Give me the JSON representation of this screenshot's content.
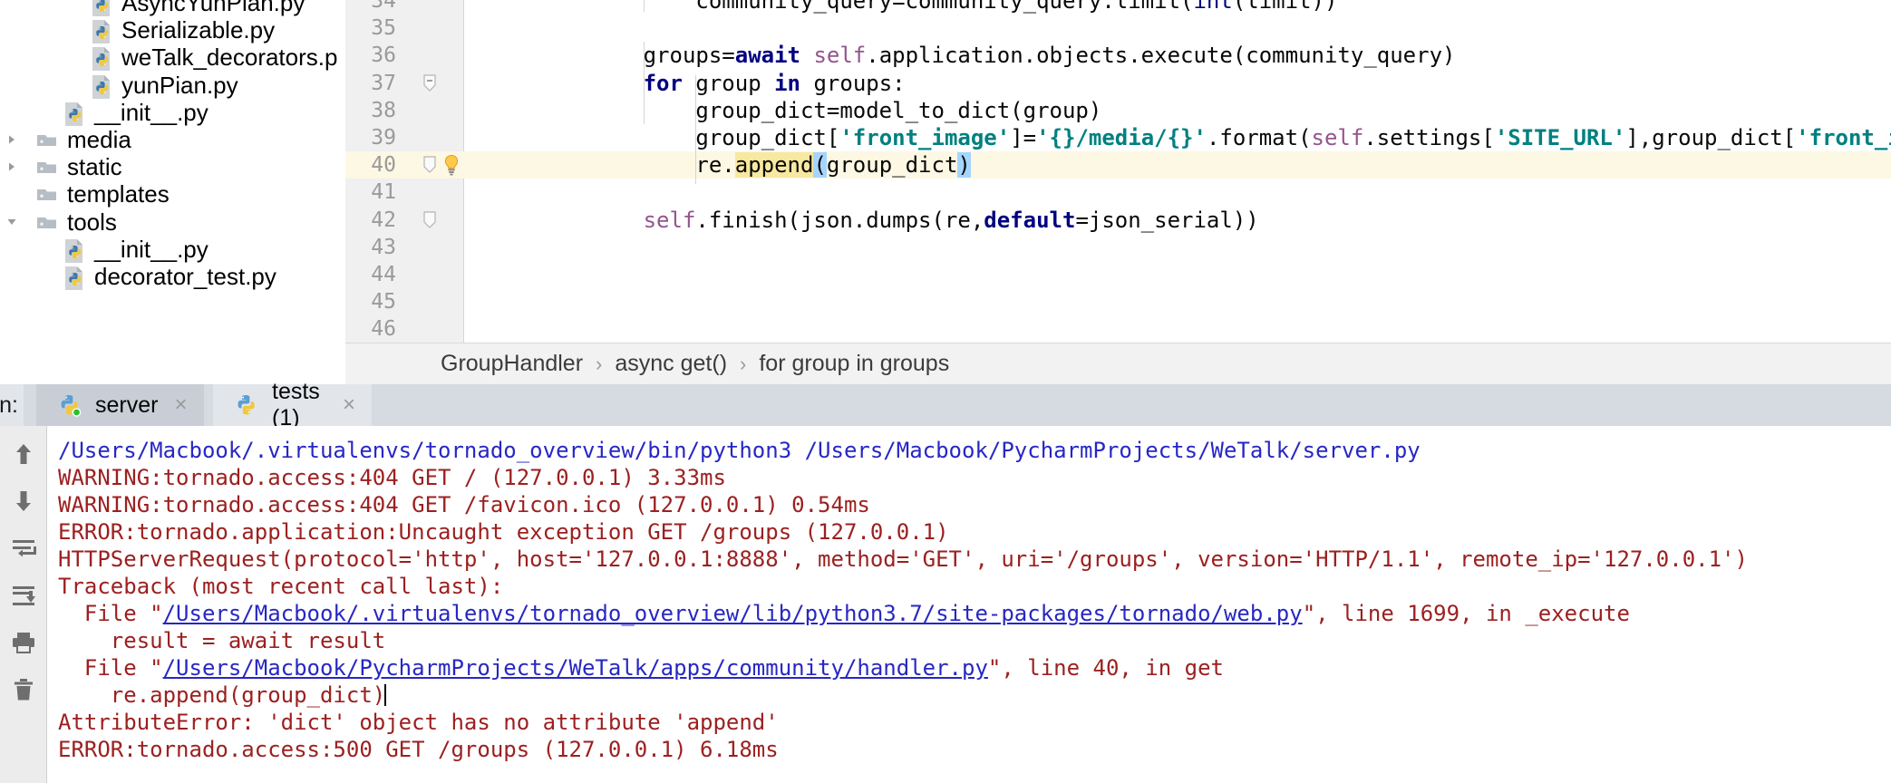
{
  "project_tree": {
    "name": "project-file-tree",
    "items": [
      {
        "label": "AsyncYunPian.py",
        "icon": "python-file-icon",
        "indent": 3,
        "type": "file",
        "expander": "none",
        "clipped_top": true
      },
      {
        "label": "Serializable.py",
        "icon": "python-file-icon",
        "indent": 3,
        "type": "file",
        "expander": "none"
      },
      {
        "label": "weTalk_decorators.p",
        "icon": "python-file-icon",
        "indent": 3,
        "type": "file",
        "expander": "none"
      },
      {
        "label": "yunPian.py",
        "icon": "python-file-icon",
        "indent": 3,
        "type": "file",
        "expander": "none"
      },
      {
        "label": "__init__.py",
        "icon": "python-file-icon",
        "indent": 2,
        "type": "file",
        "expander": "none"
      },
      {
        "label": "media",
        "icon": "folder-icon",
        "indent": 1,
        "type": "folder",
        "expander": "collapsed"
      },
      {
        "label": "static",
        "icon": "folder-icon",
        "indent": 1,
        "type": "folder",
        "expander": "collapsed"
      },
      {
        "label": "templates",
        "icon": "folder-icon",
        "indent": 1,
        "type": "folder",
        "expander": "none"
      },
      {
        "label": "tools",
        "icon": "folder-icon",
        "indent": 1,
        "type": "folder",
        "expander": "expanded"
      },
      {
        "label": "__init__.py",
        "icon": "python-file-icon",
        "indent": 2,
        "type": "file",
        "expander": "none"
      },
      {
        "label": "decorator_test.py",
        "icon": "python-file-icon",
        "indent": 2,
        "type": "file",
        "expander": "none"
      }
    ]
  },
  "editor": {
    "name": "code-editor",
    "first_line": 34,
    "highlighted_line": 40,
    "gutter_icons": {
      "fold_lines": [
        37,
        40,
        42
      ],
      "bulb_line": 40
    },
    "lines": [
      {
        "num": 34,
        "text": "            community_query=community_query.limit(int(limit))"
      },
      {
        "num": 35,
        "text": ""
      },
      {
        "num": 36,
        "text": "        groups=await self.application.objects.execute(community_query)"
      },
      {
        "num": 37,
        "text": "        for group in groups:"
      },
      {
        "num": 38,
        "text": "            group_dict=model_to_dict(group)"
      },
      {
        "num": 39,
        "text": "            group_dict['front_image']='{}/media/{}'.format(self.settings['SITE_URL'],group_dict['front_image'])"
      },
      {
        "num": 40,
        "text": "            re.append(group_dict)"
      },
      {
        "num": 41,
        "text": ""
      },
      {
        "num": 42,
        "text": "        self.finish(json.dumps(re,default=json_serial))"
      },
      {
        "num": 43,
        "text": ""
      },
      {
        "num": 44,
        "text": ""
      },
      {
        "num": 45,
        "text": ""
      },
      {
        "num": 46,
        "text": ""
      }
    ]
  },
  "breadcrumb": {
    "name": "editor-breadcrumb",
    "separator": "›",
    "items": [
      "GroupHandler",
      "async get()",
      "for group in groups"
    ]
  },
  "run_panel": {
    "name": "run-tool-window",
    "label_prefix": "n:",
    "tabs": [
      {
        "label": "server",
        "icon": "python-run-icon",
        "active": true,
        "running": true,
        "close": "×"
      },
      {
        "label": "tests (1)",
        "icon": "python-run-icon",
        "active": false,
        "running": false,
        "close": "×"
      }
    ],
    "toolbar": [
      {
        "name": "scroll-up-icon",
        "glyph": "arrow-up"
      },
      {
        "name": "scroll-down-icon",
        "glyph": "arrow-down"
      },
      {
        "name": "soft-wrap-icon",
        "glyph": "soft-wrap"
      },
      {
        "name": "scroll-to-end-icon",
        "glyph": "scroll-end"
      },
      {
        "name": "print-icon",
        "glyph": "printer"
      },
      {
        "name": "clear-all-icon",
        "glyph": "trash"
      }
    ],
    "console_lines": [
      {
        "style": "cmd",
        "parts": [
          {
            "t": "/Users/Macbook/.virtualenvs/tornado_overview/bin/python3 /Users/Macbook/PycharmProjects/WeTalk/server.py",
            "link": false
          }
        ]
      },
      {
        "style": "err",
        "parts": [
          {
            "t": "WARNING:tornado.access:404 GET / (127.0.0.1) 3.33ms",
            "link": false
          }
        ]
      },
      {
        "style": "err",
        "parts": [
          {
            "t": "WARNING:tornado.access:404 GET /favicon.ico (127.0.0.1) 0.54ms",
            "link": false
          }
        ]
      },
      {
        "style": "err",
        "parts": [
          {
            "t": "ERROR:tornado.application:Uncaught exception GET /groups (127.0.0.1)",
            "link": false
          }
        ]
      },
      {
        "style": "err",
        "parts": [
          {
            "t": "HTTPServerRequest(protocol='http', host='127.0.0.1:8888', method='GET', uri='/groups', version='HTTP/1.1', remote_ip='127.0.0.1')",
            "link": false
          }
        ]
      },
      {
        "style": "err",
        "parts": [
          {
            "t": "Traceback (most recent call last):",
            "link": false
          }
        ]
      },
      {
        "style": "err",
        "parts": [
          {
            "t": "  File \"",
            "link": false
          },
          {
            "t": "/Users/Macbook/.virtualenvs/tornado_overview/lib/python3.7/site-packages/tornado/web.py",
            "link": true
          },
          {
            "t": "\", line 1699, in _execute",
            "link": false
          }
        ]
      },
      {
        "style": "err",
        "parts": [
          {
            "t": "    result = await result",
            "link": false
          }
        ]
      },
      {
        "style": "err",
        "parts": [
          {
            "t": "  File \"",
            "link": false
          },
          {
            "t": "/Users/Macbook/PycharmProjects/WeTalk/apps/community/handler.py",
            "link": true
          },
          {
            "t": "\", line 40, in get",
            "link": false
          }
        ]
      },
      {
        "style": "err",
        "caret": true,
        "parts": [
          {
            "t": "    re.append(group_dict)",
            "link": false
          }
        ]
      },
      {
        "style": "err",
        "parts": [
          {
            "t": "AttributeError: 'dict' object has no attribute 'append'",
            "link": false
          }
        ]
      },
      {
        "style": "err",
        "parts": [
          {
            "t": "ERROR:tornado.access:500 GET /groups (127.0.0.1) 6.18ms",
            "link": false
          }
        ]
      }
    ]
  },
  "colors": {
    "keyword": "#000080",
    "string": "#008080",
    "self": "#94558d",
    "console_error": "#9c2020",
    "console_command": "#2727c4",
    "highlight_row": "#fcf8e4",
    "selection": "#a5d5ff",
    "tab_active": "#c9ced6",
    "tab_inactive": "#e2e5ea"
  }
}
